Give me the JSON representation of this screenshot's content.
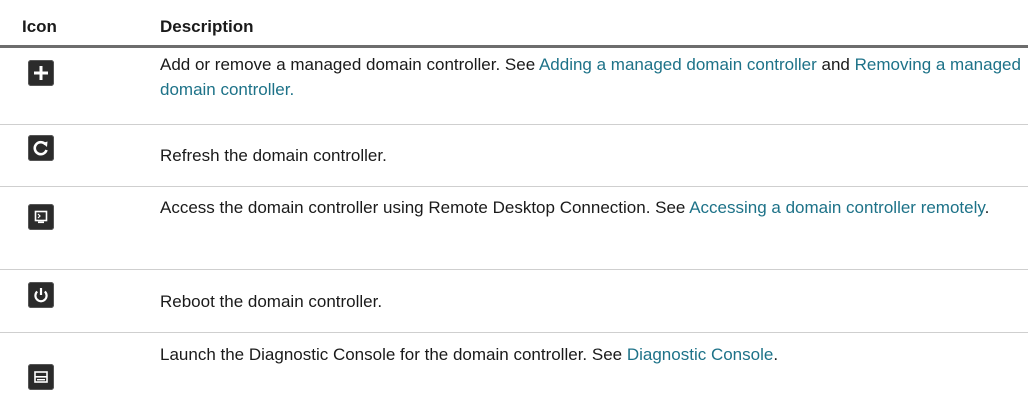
{
  "table": {
    "headers": {
      "icon": "Icon",
      "description": "Description"
    },
    "rows": [
      {
        "icon": "add-icon",
        "text_1": "Add or remove a managed domain controller. See ",
        "link_1": "Adding a managed domain controller",
        "text_2": " and ",
        "link_2": "Removing a managed domain controller.",
        "text_3": ""
      },
      {
        "icon": "refresh-icon",
        "text_1": "Refresh the domain controller."
      },
      {
        "icon": "remote-desktop-icon",
        "text_1": "Access the domain controller using Remote Desktop Connection. See ",
        "link_1": "Accessing a domain controller remotely",
        "text_2": "."
      },
      {
        "icon": "power-icon",
        "text_1": "Reboot the domain controller."
      },
      {
        "icon": "diagnostic-console-icon",
        "text_1": "Launch the Diagnostic Console for the domain controller. See ",
        "link_1": "Diagnostic Console",
        "text_2": "."
      }
    ]
  }
}
